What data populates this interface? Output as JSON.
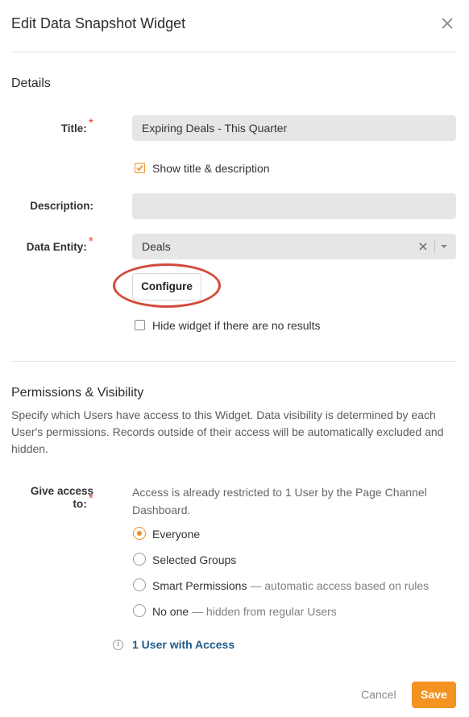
{
  "dialog": {
    "title": "Edit Data Snapshot Widget"
  },
  "details": {
    "section_title": "Details",
    "title_label": "Title:",
    "title_value": "Expiring Deals - This Quarter",
    "show_title_label": "Show title & description",
    "show_title_checked": true,
    "description_label": "Description:",
    "description_value": "",
    "data_entity_label": "Data Entity:",
    "data_entity_value": "Deals",
    "configure_label": "Configure",
    "hide_widget_label": "Hide widget if there are no results",
    "hide_widget_checked": false
  },
  "permissions": {
    "section_title": "Permissions & Visibility",
    "description": "Specify which Users have access to this Widget. Data visibility is determined by each User's permissions. Records outside of their access will be automatically excluded and hidden.",
    "give_access_label": "Give access to:",
    "note": "Access is already restricted to 1 User by the Page Channel Dashboard.",
    "options": [
      {
        "label": "Everyone",
        "sub": "",
        "selected": true
      },
      {
        "label": "Selected Groups",
        "sub": "",
        "selected": false
      },
      {
        "label": "Smart Permissions",
        "sub": " — automatic access based on rules",
        "selected": false
      },
      {
        "label": "No one",
        "sub": " — hidden from regular Users",
        "selected": false
      }
    ],
    "access_link": "1 User with Access"
  },
  "footer": {
    "cancel_label": "Cancel",
    "save_label": "Save"
  },
  "colors": {
    "accent": "#f39322",
    "required": "#e5483a",
    "link": "#1f5b8a",
    "annotation": "#d24a3a"
  }
}
